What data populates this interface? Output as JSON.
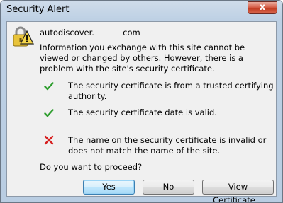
{
  "window": {
    "title": "Security Alert",
    "close_glyph": "x"
  },
  "dialog": {
    "icon": "security-warning-padlock-icon",
    "domain": "autodiscover.           com",
    "info": "Information you exchange with this site cannot be viewed or changed by others. However, there is a problem with the site's security certificate.",
    "checks": [
      {
        "status": "ok",
        "icon": "green-check-icon",
        "text": "The security certificate is from a trusted certifying authority."
      },
      {
        "status": "ok",
        "icon": "green-check-icon",
        "text": "The security certificate date is valid."
      },
      {
        "status": "error",
        "icon": "red-x-icon",
        "text": "The name on the security certificate is invalid or does not match the name of the site."
      }
    ],
    "question": "Do you want to proceed?"
  },
  "buttons": {
    "yes": "Yes",
    "no": "No",
    "view_certificate": "View Certificate..."
  },
  "colors": {
    "check": "#2f9e2f",
    "error": "#d61f1f",
    "warning_yellow": "#f5d64a"
  }
}
